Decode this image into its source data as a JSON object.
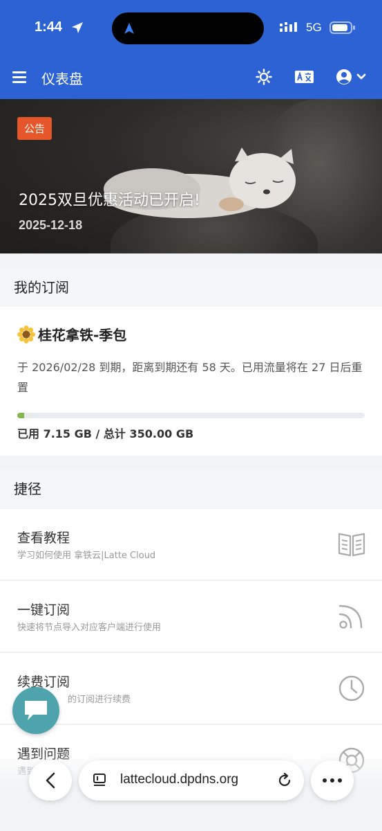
{
  "status_bar": {
    "time": "1:44",
    "network": "5G"
  },
  "header": {
    "title": "仪表盘"
  },
  "banner": {
    "badge": "公告",
    "title": "2025双旦优惠活动已开启!",
    "date": "2025-12-18"
  },
  "subscription": {
    "section_title": "我的订阅",
    "plan_name": "桂花拿铁-季包",
    "description": "于 2026/02/28 到期，距离到期还有 58 天。已用流量将在 27 日后重置",
    "usage_text": "已用 7.15 GB / 总计 350.00 GB",
    "used_fraction": 0.0204,
    "progress_color": "#82b74b"
  },
  "shortcuts": {
    "section_title": "捷径",
    "items": [
      {
        "title": "查看教程",
        "subtitle": "学习如何使用 拿铁云|Latte Cloud",
        "icon": "book-icon"
      },
      {
        "title": "一键订阅",
        "subtitle": "快速将节点导入对应客户端进行使用",
        "icon": "rss-icon"
      },
      {
        "title": "续费订阅",
        "subtitle": "的订阅进行续费",
        "icon": "clock-icon"
      },
      {
        "title": "遇到问题",
        "subtitle": "遇到",
        "icon": "lifebuoy-icon"
      }
    ]
  },
  "browser": {
    "url": "lattecloud.dpdns.org"
  },
  "colors": {
    "header_bg": "#2c62d3",
    "badge_bg": "#e5562a",
    "fab_bg": "#4fa3ad"
  }
}
